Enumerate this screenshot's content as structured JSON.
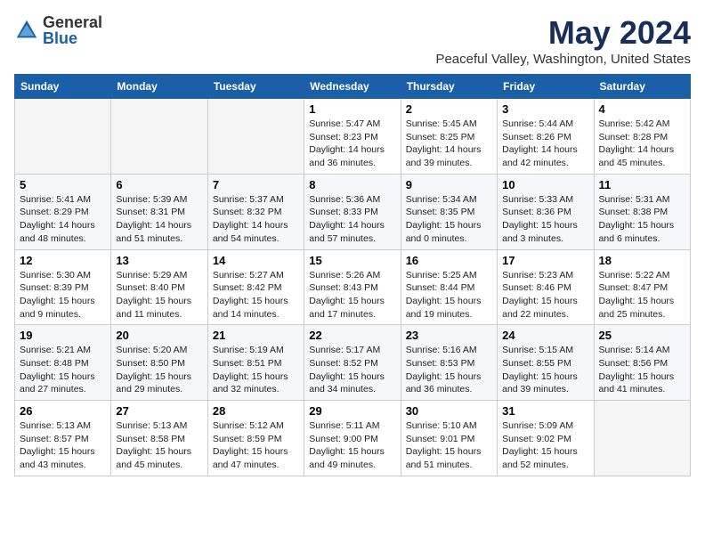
{
  "logo": {
    "general": "General",
    "blue": "Blue"
  },
  "title": "May 2024",
  "location": "Peaceful Valley, Washington, United States",
  "days_header": [
    "Sunday",
    "Monday",
    "Tuesday",
    "Wednesday",
    "Thursday",
    "Friday",
    "Saturday"
  ],
  "weeks": [
    [
      {
        "day": "",
        "info": ""
      },
      {
        "day": "",
        "info": ""
      },
      {
        "day": "",
        "info": ""
      },
      {
        "day": "1",
        "info": "Sunrise: 5:47 AM\nSunset: 8:23 PM\nDaylight: 14 hours\nand 36 minutes."
      },
      {
        "day": "2",
        "info": "Sunrise: 5:45 AM\nSunset: 8:25 PM\nDaylight: 14 hours\nand 39 minutes."
      },
      {
        "day": "3",
        "info": "Sunrise: 5:44 AM\nSunset: 8:26 PM\nDaylight: 14 hours\nand 42 minutes."
      },
      {
        "day": "4",
        "info": "Sunrise: 5:42 AM\nSunset: 8:28 PM\nDaylight: 14 hours\nand 45 minutes."
      }
    ],
    [
      {
        "day": "5",
        "info": "Sunrise: 5:41 AM\nSunset: 8:29 PM\nDaylight: 14 hours\nand 48 minutes."
      },
      {
        "day": "6",
        "info": "Sunrise: 5:39 AM\nSunset: 8:31 PM\nDaylight: 14 hours\nand 51 minutes."
      },
      {
        "day": "7",
        "info": "Sunrise: 5:37 AM\nSunset: 8:32 PM\nDaylight: 14 hours\nand 54 minutes."
      },
      {
        "day": "8",
        "info": "Sunrise: 5:36 AM\nSunset: 8:33 PM\nDaylight: 14 hours\nand 57 minutes."
      },
      {
        "day": "9",
        "info": "Sunrise: 5:34 AM\nSunset: 8:35 PM\nDaylight: 15 hours\nand 0 minutes."
      },
      {
        "day": "10",
        "info": "Sunrise: 5:33 AM\nSunset: 8:36 PM\nDaylight: 15 hours\nand 3 minutes."
      },
      {
        "day": "11",
        "info": "Sunrise: 5:31 AM\nSunset: 8:38 PM\nDaylight: 15 hours\nand 6 minutes."
      }
    ],
    [
      {
        "day": "12",
        "info": "Sunrise: 5:30 AM\nSunset: 8:39 PM\nDaylight: 15 hours\nand 9 minutes."
      },
      {
        "day": "13",
        "info": "Sunrise: 5:29 AM\nSunset: 8:40 PM\nDaylight: 15 hours\nand 11 minutes."
      },
      {
        "day": "14",
        "info": "Sunrise: 5:27 AM\nSunset: 8:42 PM\nDaylight: 15 hours\nand 14 minutes."
      },
      {
        "day": "15",
        "info": "Sunrise: 5:26 AM\nSunset: 8:43 PM\nDaylight: 15 hours\nand 17 minutes."
      },
      {
        "day": "16",
        "info": "Sunrise: 5:25 AM\nSunset: 8:44 PM\nDaylight: 15 hours\nand 19 minutes."
      },
      {
        "day": "17",
        "info": "Sunrise: 5:23 AM\nSunset: 8:46 PM\nDaylight: 15 hours\nand 22 minutes."
      },
      {
        "day": "18",
        "info": "Sunrise: 5:22 AM\nSunset: 8:47 PM\nDaylight: 15 hours\nand 25 minutes."
      }
    ],
    [
      {
        "day": "19",
        "info": "Sunrise: 5:21 AM\nSunset: 8:48 PM\nDaylight: 15 hours\nand 27 minutes."
      },
      {
        "day": "20",
        "info": "Sunrise: 5:20 AM\nSunset: 8:50 PM\nDaylight: 15 hours\nand 29 minutes."
      },
      {
        "day": "21",
        "info": "Sunrise: 5:19 AM\nSunset: 8:51 PM\nDaylight: 15 hours\nand 32 minutes."
      },
      {
        "day": "22",
        "info": "Sunrise: 5:17 AM\nSunset: 8:52 PM\nDaylight: 15 hours\nand 34 minutes."
      },
      {
        "day": "23",
        "info": "Sunrise: 5:16 AM\nSunset: 8:53 PM\nDaylight: 15 hours\nand 36 minutes."
      },
      {
        "day": "24",
        "info": "Sunrise: 5:15 AM\nSunset: 8:55 PM\nDaylight: 15 hours\nand 39 minutes."
      },
      {
        "day": "25",
        "info": "Sunrise: 5:14 AM\nSunset: 8:56 PM\nDaylight: 15 hours\nand 41 minutes."
      }
    ],
    [
      {
        "day": "26",
        "info": "Sunrise: 5:13 AM\nSunset: 8:57 PM\nDaylight: 15 hours\nand 43 minutes."
      },
      {
        "day": "27",
        "info": "Sunrise: 5:13 AM\nSunset: 8:58 PM\nDaylight: 15 hours\nand 45 minutes."
      },
      {
        "day": "28",
        "info": "Sunrise: 5:12 AM\nSunset: 8:59 PM\nDaylight: 15 hours\nand 47 minutes."
      },
      {
        "day": "29",
        "info": "Sunrise: 5:11 AM\nSunset: 9:00 PM\nDaylight: 15 hours\nand 49 minutes."
      },
      {
        "day": "30",
        "info": "Sunrise: 5:10 AM\nSunset: 9:01 PM\nDaylight: 15 hours\nand 51 minutes."
      },
      {
        "day": "31",
        "info": "Sunrise: 5:09 AM\nSunset: 9:02 PM\nDaylight: 15 hours\nand 52 minutes."
      },
      {
        "day": "",
        "info": ""
      }
    ]
  ]
}
